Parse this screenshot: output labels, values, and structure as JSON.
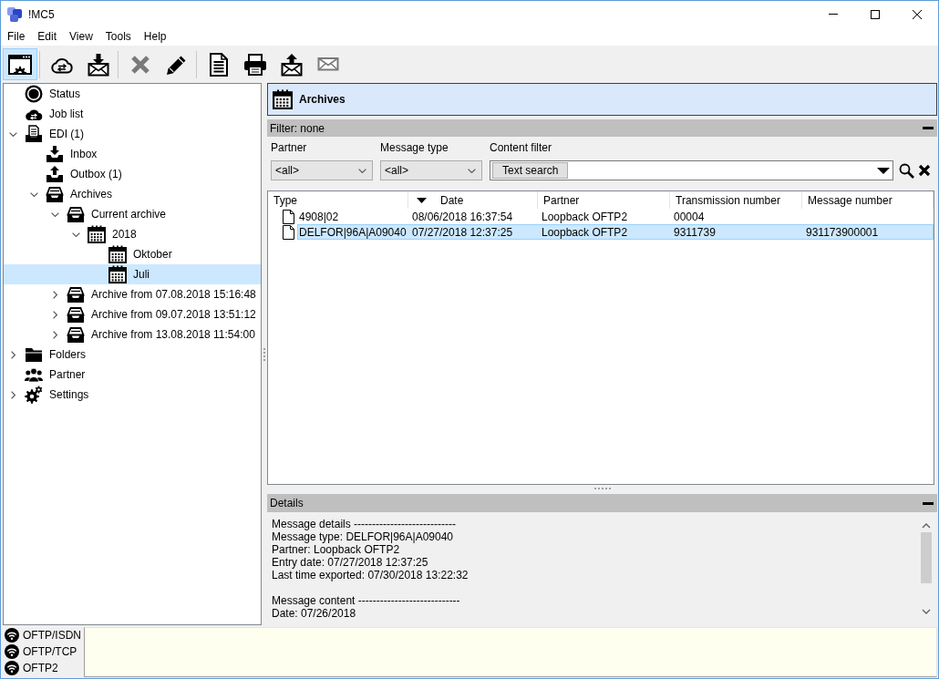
{
  "window": {
    "title": "!MC5"
  },
  "menu": [
    "File",
    "Edit",
    "View",
    "Tools",
    "Help"
  ],
  "toolbar": [
    {
      "buttons": [
        {
          "kind": "view",
          "selected": true,
          "disabled": false
        }
      ]
    },
    {
      "buttons": [
        {
          "kind": "sync",
          "selected": false,
          "disabled": false
        },
        {
          "kind": "receive",
          "selected": false,
          "disabled": false
        }
      ]
    },
    {
      "buttons": [
        {
          "kind": "delete",
          "selected": false,
          "disabled": true
        },
        {
          "kind": "edit",
          "selected": false,
          "disabled": false
        }
      ]
    },
    {
      "buttons": [
        {
          "kind": "document",
          "selected": false,
          "disabled": false
        },
        {
          "kind": "print",
          "selected": false,
          "disabled": false
        },
        {
          "kind": "send",
          "selected": false,
          "disabled": false
        },
        {
          "kind": "mail",
          "selected": false,
          "disabled": true
        }
      ]
    }
  ],
  "tree": [
    {
      "label": "Status",
      "kind": "status",
      "selected": false
    },
    {
      "label": "Job list",
      "kind": "jobs",
      "selected": false
    },
    {
      "label": "EDI (1)",
      "kind": "edi",
      "selected": false,
      "expanded": true,
      "children": [
        {
          "label": "Inbox",
          "kind": "inbox",
          "selected": false
        },
        {
          "label": "Outbox (1)",
          "kind": "outbox",
          "selected": false
        },
        {
          "label": "Archives",
          "kind": "archive",
          "selected": false,
          "expanded": true,
          "children": [
            {
              "label": "Current archive",
              "kind": "archive",
              "selected": false,
              "expanded": true,
              "children": [
                {
                  "label": "2018",
                  "kind": "calendar",
                  "selected": false,
                  "expanded": true,
                  "children": [
                    {
                      "label": "Oktober",
                      "kind": "calendar",
                      "selected": false
                    },
                    {
                      "label": "Juli",
                      "kind": "calendar",
                      "selected": true
                    }
                  ]
                }
              ]
            },
            {
              "label": "Archive from 07.08.2018 15:16:48",
              "kind": "archive",
              "selected": false,
              "expanded": false
            },
            {
              "label": "Archive from 09.07.2018 13:51:12",
              "kind": "archive",
              "selected": false,
              "expanded": false
            },
            {
              "label": "Archive from 13.08.2018 11:54:00",
              "kind": "archive",
              "selected": false,
              "expanded": false
            }
          ]
        }
      ]
    },
    {
      "label": "Folders",
      "kind": "folder",
      "selected": false,
      "expanded": false
    },
    {
      "label": "Partner",
      "kind": "partner",
      "selected": false
    },
    {
      "label": "Settings",
      "kind": "settings",
      "selected": false,
      "expanded": false
    }
  ],
  "content": {
    "header": {
      "title": "Archives"
    },
    "filter": {
      "title": "Filter: none",
      "dropdowns": [
        {
          "label": "Partner",
          "value": "<all>"
        },
        {
          "label": "Message type",
          "value": "<all>"
        }
      ],
      "content_filter": {
        "label": "Content filter",
        "button": "Text search"
      }
    },
    "table": {
      "columns": [
        {
          "label": "Type",
          "sorted": false
        },
        {
          "label": "Date",
          "sorted": true
        },
        {
          "label": "Partner",
          "sorted": false
        },
        {
          "label": "Transmission number",
          "sorted": false
        },
        {
          "label": "Message number",
          "sorted": false
        }
      ],
      "rows": [
        {
          "cells": [
            "4908|02",
            "08/06/2018 16:37:54",
            "Loopback OFTP2",
            "00004"
          ],
          "selected": false
        },
        {
          "cells": [
            "DELFOR|96A|A09040",
            "07/27/2018 12:37:25",
            "Loopback OFTP2",
            "9311739",
            "931173900001"
          ],
          "selected": true
        }
      ]
    },
    "details": {
      "title": "Details",
      "sections": [
        {
          "lines": [
            "Message details ----------------------------",
            "Message type: DELFOR|96A|A09040",
            "Partner: Loopback OFTP2",
            "Entry date: 07/27/2018 12:37:25",
            "Last time exported: 07/30/2018 13:22:32"
          ]
        },
        {
          "lines": [
            "Message content ----------------------------",
            "Date: 07/26/2018"
          ]
        }
      ]
    }
  },
  "connections": [
    "OFTP/ISDN",
    "OFTP/TCP",
    "OFTP2"
  ]
}
